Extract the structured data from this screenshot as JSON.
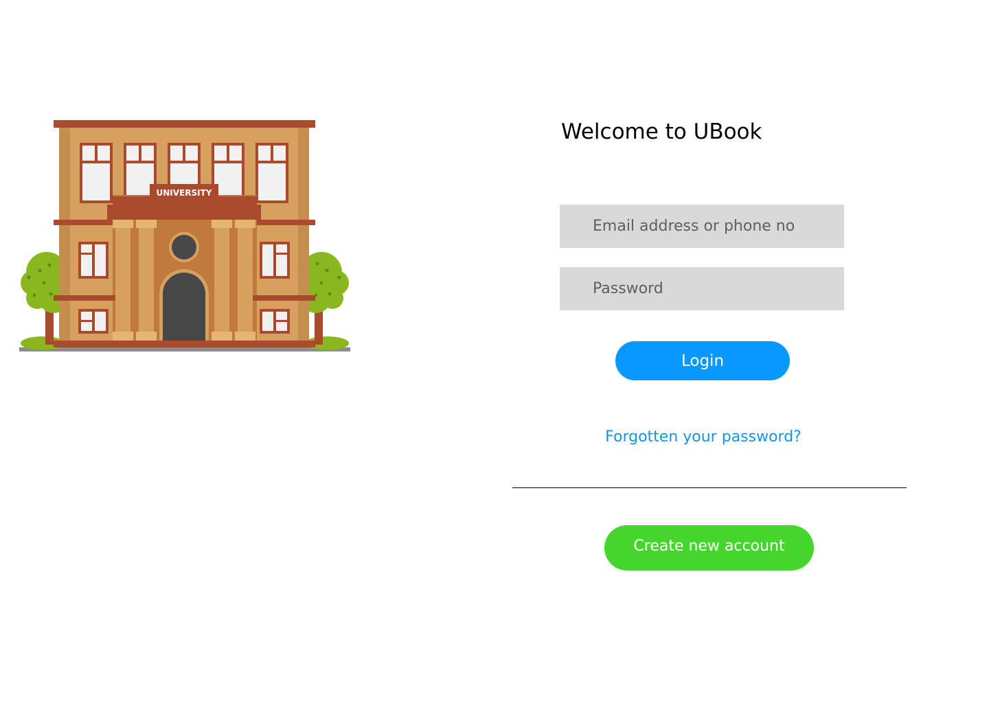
{
  "illustration": {
    "icon": "university-building-icon",
    "sign_text": "UNIVERSITY"
  },
  "welcome": {
    "title": "Welcome to UBook"
  },
  "form": {
    "email_placeholder": "Email address or phone no",
    "email_value": "",
    "password_placeholder": "Password",
    "password_value": "",
    "login_label": "Login",
    "forgot_label": "Forgotten your password?",
    "create_label": "Create new account"
  },
  "colors": {
    "login": "#0898ff",
    "link": "#1594e8",
    "create": "#44d62c",
    "field": "#d9d9d9"
  }
}
